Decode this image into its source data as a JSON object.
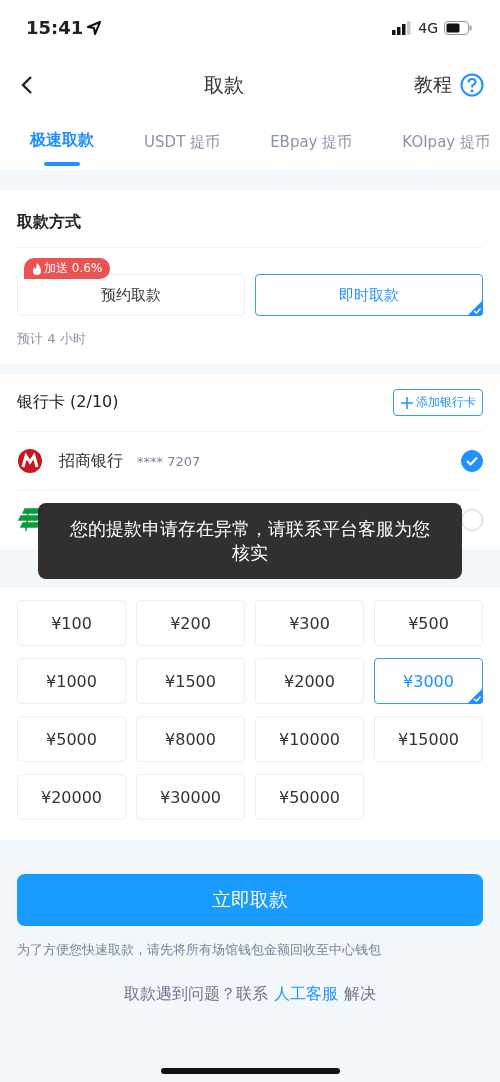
{
  "status_bar": {
    "time": "15:41",
    "network": "4G"
  },
  "nav": {
    "title": "取款",
    "help": "教程"
  },
  "tabs": [
    {
      "label": "极速取款",
      "selected": true
    },
    {
      "label": "USDT 提币",
      "selected": false
    },
    {
      "label": "EBpay 提币",
      "selected": false
    },
    {
      "label": "KOIpay 提币",
      "selected": false
    }
  ],
  "withdraw_method": {
    "title": "取款方式",
    "badge": "加送 0.6%",
    "options": [
      {
        "label": "预约取款",
        "selected": false
      },
      {
        "label": "即时取款",
        "selected": true
      }
    ],
    "estimate": "预计 4 小时"
  },
  "bank_cards": {
    "title": "银行卡 (2/10)",
    "add_button": "添加银行卡",
    "cards": [
      {
        "name": "招商银行",
        "number": "**** 7207",
        "selected": true
      },
      {
        "selected": false
      }
    ]
  },
  "amounts": [
    {
      "label": "¥100",
      "selected": false
    },
    {
      "label": "¥200",
      "selected": false
    },
    {
      "label": "¥300",
      "selected": false
    },
    {
      "label": "¥500",
      "selected": false
    },
    {
      "label": "¥1000",
      "selected": false
    },
    {
      "label": "¥1500",
      "selected": false
    },
    {
      "label": "¥2000",
      "selected": false
    },
    {
      "label": "¥3000",
      "selected": true
    },
    {
      "label": "¥5000",
      "selected": false
    },
    {
      "label": "¥8000",
      "selected": false
    },
    {
      "label": "¥10000",
      "selected": false
    },
    {
      "label": "¥15000",
      "selected": false
    },
    {
      "label": "¥20000",
      "selected": false
    },
    {
      "label": "¥30000",
      "selected": false
    },
    {
      "label": "¥50000",
      "selected": false
    }
  ],
  "submit": "立即取款",
  "note": "为了方便您快速取款，请先将所有场馆钱包金额回收至中心钱包",
  "help": {
    "before": "取款遇到问题？联系",
    "link": "人工客服",
    "after": "解决"
  },
  "toast": "您的提款申请存在异常，请联系平台客服为您核实"
}
